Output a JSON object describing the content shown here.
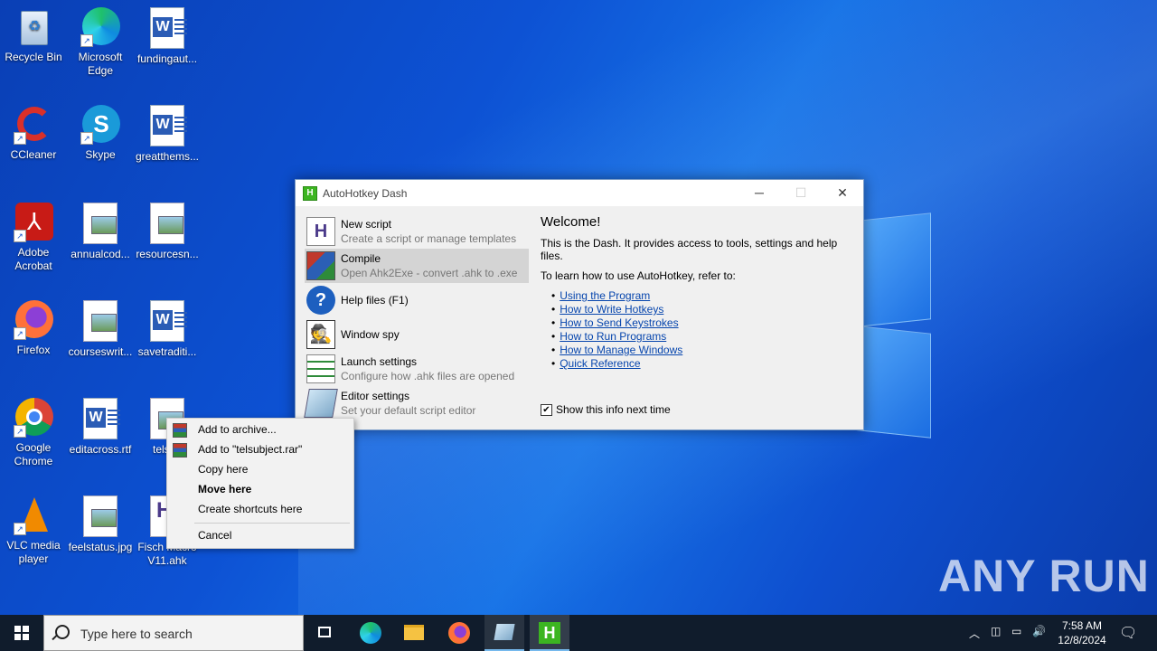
{
  "desktop": {
    "icons": [
      {
        "label": "Recycle Bin",
        "icon": "recycle-bin-icon"
      },
      {
        "label": "Microsoft Edge",
        "icon": "edge-icon"
      },
      {
        "label": "fundingaut...",
        "icon": "word-doc-icon"
      },
      {
        "label": "CCleaner",
        "icon": "ccleaner-icon"
      },
      {
        "label": "Skype",
        "icon": "skype-icon"
      },
      {
        "label": "greatthems...",
        "icon": "word-doc-icon"
      },
      {
        "label": "Adobe Acrobat",
        "icon": "acrobat-icon"
      },
      {
        "label": "annualcod...",
        "icon": "image-file-icon"
      },
      {
        "label": "resourcesn...",
        "icon": "image-file-icon"
      },
      {
        "label": "Firefox",
        "icon": "firefox-icon"
      },
      {
        "label": "courseswrit...",
        "icon": "image-file-icon"
      },
      {
        "label": "savetraditi...",
        "icon": "word-doc-icon"
      },
      {
        "label": "Google Chrome",
        "icon": "chrome-icon"
      },
      {
        "label": "editacross.rtf",
        "icon": "word-doc-icon"
      },
      {
        "label": "telsub",
        "icon": "image-file-icon"
      },
      {
        "label": "VLC media player",
        "icon": "vlc-icon"
      },
      {
        "label": "feelstatus.jpg",
        "icon": "image-file-icon"
      },
      {
        "label": "Fisch Macro V11.ahk",
        "icon": "ahk-file-icon"
      }
    ]
  },
  "dash": {
    "title": "AutoHotkey Dash",
    "menu": [
      {
        "title": "New script",
        "subtitle": "Create a script or manage templates"
      },
      {
        "title": "Compile",
        "subtitle": "Open Ahk2Exe - convert .ahk to .exe"
      },
      {
        "title": "Help files (F1)",
        "subtitle": ""
      },
      {
        "title": "Window spy",
        "subtitle": ""
      },
      {
        "title": "Launch settings",
        "subtitle": "Configure how .ahk files are opened"
      },
      {
        "title": "Editor settings",
        "subtitle": "Set your default script editor"
      }
    ],
    "welcome": "Welcome!",
    "intro": "This is the Dash. It provides access to tools, settings and help files.",
    "learn": "To learn how to use AutoHotkey, refer to:",
    "links": [
      "Using the Program",
      "How to Write Hotkeys",
      "How to Send Keystrokes",
      "How to Run Programs",
      "How to Manage Windows",
      "Quick Reference"
    ],
    "show_info": "Show this info next time",
    "show_info_checked": true
  },
  "context_menu": {
    "items": [
      "Add to archive...",
      "Add to \"telsubject.rar\"",
      "Copy here",
      "Move here",
      "Create shortcuts here",
      "Cancel"
    ]
  },
  "taskbar": {
    "search_placeholder": "Type here to search",
    "time": "7:58 AM",
    "date": "12/8/2024"
  },
  "watermark": "ANY RUN"
}
